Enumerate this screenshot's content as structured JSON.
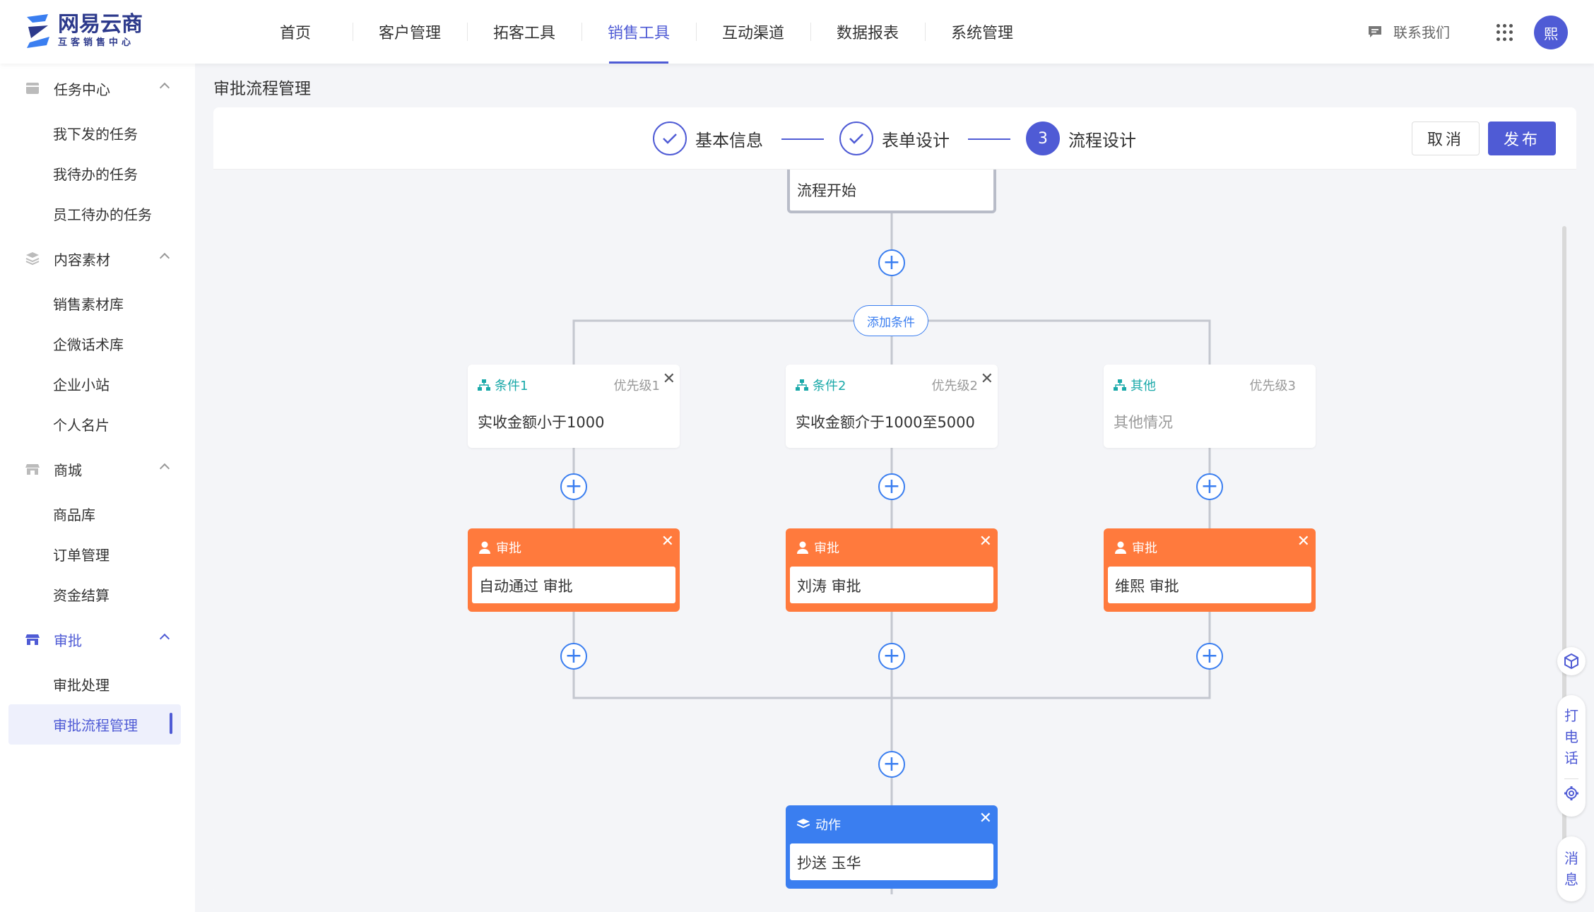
{
  "brand": {
    "name": "网易云商",
    "sub": "互客销售中心"
  },
  "nav": [
    "首页",
    "客户管理",
    "拓客工具",
    "销售工具",
    "互动渠道",
    "数据报表",
    "系统管理"
  ],
  "nav_active": 3,
  "header": {
    "contact": "联系我们",
    "avatar": "熙"
  },
  "sidebar": {
    "groups": [
      {
        "label": "任务中心",
        "items": [
          "我下发的任务",
          "我待办的任务",
          "员工待办的任务"
        ]
      },
      {
        "label": "内容素材",
        "items": [
          "销售素材库",
          "企微话术库",
          "企业小站",
          "个人名片"
        ]
      },
      {
        "label": "商城",
        "items": [
          "商品库",
          "订单管理",
          "资金结算"
        ]
      },
      {
        "label": "审批",
        "items": [
          "审批处理",
          "审批流程管理"
        ]
      }
    ],
    "active_group": "审批",
    "active_item": "审批流程管理"
  },
  "page": {
    "title": "审批流程管理"
  },
  "steps": [
    {
      "label": "基本信息",
      "state": "done"
    },
    {
      "label": "表单设计",
      "state": "done"
    },
    {
      "label": "流程设计",
      "num": "3",
      "state": "current"
    }
  ],
  "actions": {
    "cancel": "取消",
    "publish": "发布"
  },
  "flow": {
    "start": "流程开始",
    "add_condition": "添加条件",
    "conditions": [
      {
        "tag": "条件1",
        "priority": "优先级1",
        "text": "实收金额小于1000",
        "closable": true
      },
      {
        "tag": "条件2",
        "priority": "优先级2",
        "text": "实收金额介于1000至5000",
        "closable": true
      },
      {
        "tag": "其他",
        "priority": "优先级3",
        "text": "其他情况",
        "closable": false
      }
    ],
    "approvals": [
      {
        "tag": "审批",
        "text": "自动通过 审批"
      },
      {
        "tag": "审批",
        "text": "刘涛 审批"
      },
      {
        "tag": "审批",
        "text": "维熙 审批"
      }
    ],
    "action": {
      "tag": "动作",
      "text": "抄送 玉华"
    }
  },
  "floating": {
    "call": "打电话",
    "message": "消息"
  },
  "colors": {
    "primary": "#4f5bd5",
    "approval": "#ff7a3d",
    "action": "#3a7ef0",
    "condition": "#1aa9a9"
  }
}
